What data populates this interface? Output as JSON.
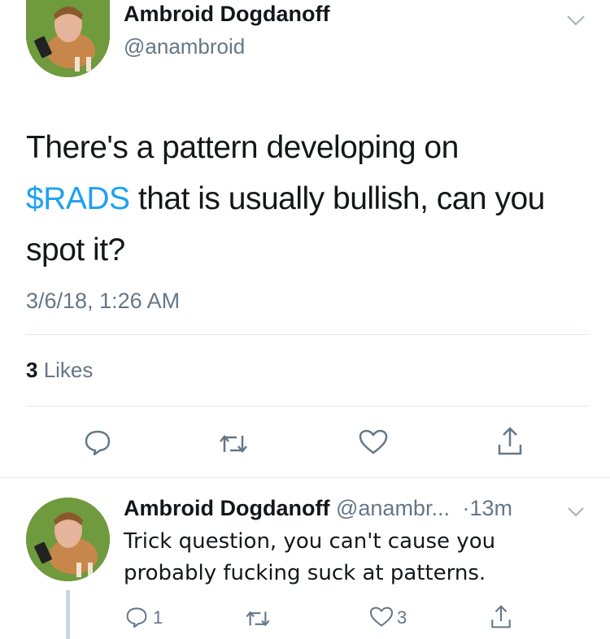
{
  "tweet": {
    "display_name": "Ambroid Dogdanoff",
    "handle": "@anambroid",
    "text_before_link": "There's a pattern developing on",
    "cashtag": "$RADS",
    "text_after_link": " that is usually bullish, can you",
    "text_line3": "spot it?",
    "timestamp": "3/6/18, 1:26 AM",
    "likes_count": "3",
    "likes_label": " Likes"
  },
  "reply": {
    "display_name": "Ambroid Dogdanoff",
    "handle": "@anambr...",
    "time": "·13m",
    "text_line1": "Trick question, you can't cause you",
    "text_line2": "probably fucking suck at patterns.",
    "reply_count": "1",
    "like_count": "3"
  },
  "icons": [
    "chevron-down-icon",
    "reply-icon",
    "retweet-icon",
    "like-icon",
    "share-icon"
  ],
  "colors": {
    "link": "#1da1f2",
    "muted": "#657786",
    "divider": "#e1e8ed"
  }
}
